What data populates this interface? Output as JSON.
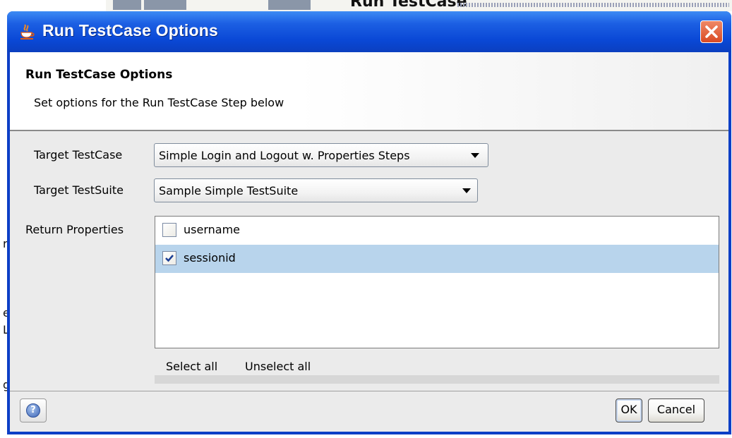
{
  "dialog": {
    "title": "Run TestCase Options"
  },
  "background": {
    "title": "Run TestCase"
  },
  "header": {
    "title": "Run TestCase Options",
    "description": "Set options for the Run TestCase Step below"
  },
  "form": {
    "target_testcase_label": "Target TestCase",
    "target_testcase_value": "Simple Login and Logout w. Properties Steps",
    "target_testsuite_label": "Target TestSuite",
    "target_testsuite_value": "Sample Simple TestSuite",
    "return_properties_label": "Return Properties",
    "properties": [
      {
        "label": "username",
        "checked": false
      },
      {
        "label": "sessionid",
        "checked": true
      }
    ],
    "select_all": "Select all",
    "unselect_all": "Unselect all"
  },
  "footer": {
    "help_icon": "help-icon",
    "ok_label": "OK",
    "cancel_label": "Cancel"
  },
  "colors": {
    "titlebar": "#0a48d6",
    "selection": "#b8d4ec",
    "close": "#d94a24"
  }
}
